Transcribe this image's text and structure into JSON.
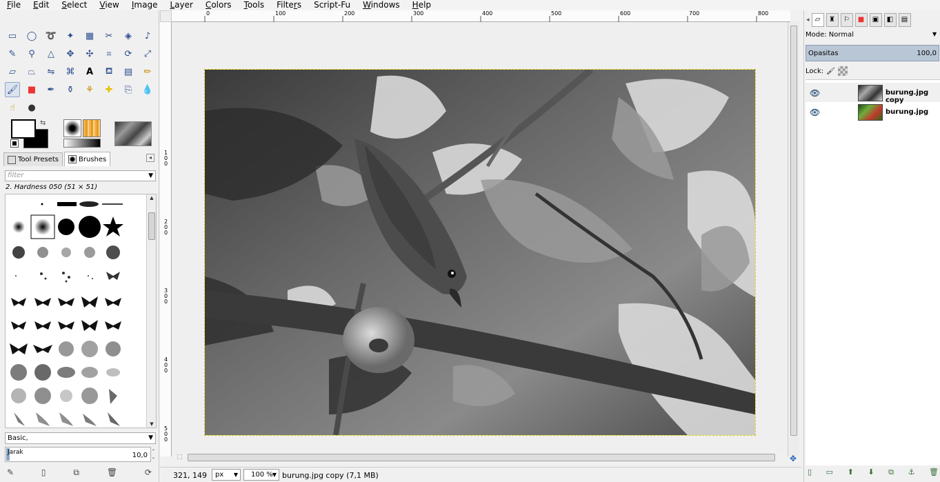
{
  "menu": [
    "File",
    "Edit",
    "Select",
    "View",
    "Image",
    "Layer",
    "Colors",
    "Tools",
    "Filters",
    "Script-Fu",
    "Windows",
    "Help"
  ],
  "menu_accel": [
    "F",
    "E",
    "S",
    "V",
    "I",
    "L",
    "C",
    "T",
    "r",
    "",
    "W",
    "H"
  ],
  "toolbox": {
    "tab_tool_presets": "Tool Presets",
    "tab_brushes": "Brushes",
    "filter_placeholder": "filter",
    "brush_name": "2. Hardness 050 (51 × 51)",
    "brush_set": "Basic,",
    "spacing_label": "Jarak",
    "spacing_value": "10,0"
  },
  "ruler": {
    "h_ticks": [
      "0",
      "100",
      "200",
      "300",
      "400",
      "500",
      "600",
      "700",
      "800"
    ],
    "v_ticks": [
      "1\n0\n0",
      "2\n0\n0",
      "3\n0\n0",
      "4\n0\n0",
      "5\n0\n0"
    ]
  },
  "status": {
    "coords": "321, 149",
    "unit": "px",
    "zoom": "100 %",
    "message": "burung.jpg copy (7,1 MB)"
  },
  "layers": {
    "mode_label": "Mode: Normal",
    "opacity_label": "Opasitas",
    "opacity_value": "100,0",
    "lock_label": "Lock:",
    "items": [
      {
        "name": "burung.jpg copy",
        "selected": true
      },
      {
        "name": "burung.jpg",
        "selected": false
      }
    ]
  },
  "colors": {
    "accent": "#1b5fb5",
    "selection": "#e0d000",
    "opacity_bar": "#b9c6d6"
  }
}
